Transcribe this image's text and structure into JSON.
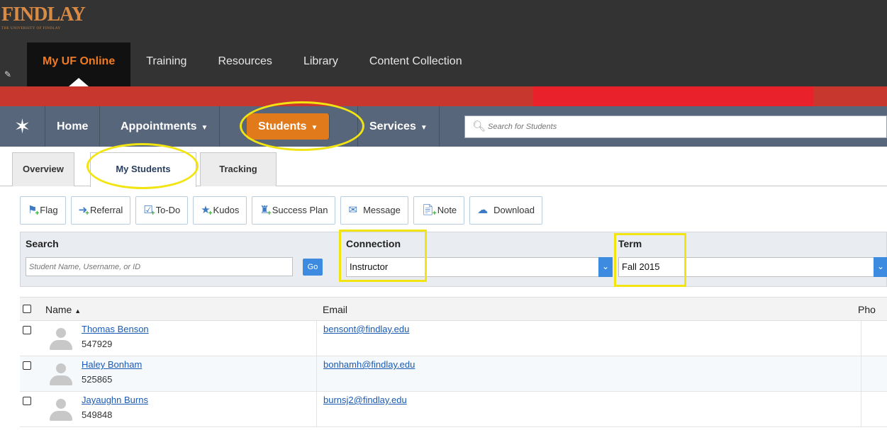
{
  "university": {
    "logo_text": "FINDLAY",
    "logo_sub": "THE UNIVERSITY OF FINDLAY"
  },
  "top_tabs": [
    {
      "label": "My UF Online",
      "active": true
    },
    {
      "label": "Training"
    },
    {
      "label": "Resources"
    },
    {
      "label": "Library"
    },
    {
      "label": "Content Collection"
    }
  ],
  "app_nav": {
    "home": "Home",
    "appointments": "Appointments",
    "students": "Students",
    "services": "Services",
    "search_placeholder": "Search for Students"
  },
  "sub_tabs": {
    "overview": "Overview",
    "my_students": "My Students",
    "tracking": "Tracking"
  },
  "actions": {
    "flag": "Flag",
    "referral": "Referral",
    "todo": "To-Do",
    "kudos": "Kudos",
    "success_plan": "Success Plan",
    "message": "Message",
    "note": "Note",
    "download": "Download"
  },
  "filters": {
    "search_label": "Search",
    "search_placeholder": "Student Name, Username, or ID",
    "go": "Go",
    "connection_label": "Connection",
    "connection_value": "Instructor",
    "term_label": "Term",
    "term_value": "Fall 2015"
  },
  "table": {
    "headers": {
      "name": "Name",
      "email": "Email",
      "phone": "Pho"
    },
    "rows": [
      {
        "name": "Thomas Benson",
        "id": "547929",
        "email": "bensont@findlay.edu"
      },
      {
        "name": "Haley Bonham",
        "id": "525865",
        "email": "bonhamh@findlay.edu"
      },
      {
        "name": "Jayaughn Burns",
        "id": "549848",
        "email": "burnsj2@findlay.edu"
      }
    ]
  },
  "colors": {
    "accent_orange": "#e07a1b",
    "nav_slate": "#57667a",
    "highlight_yellow": "#f2e410",
    "link_blue": "#1a5ab3"
  }
}
